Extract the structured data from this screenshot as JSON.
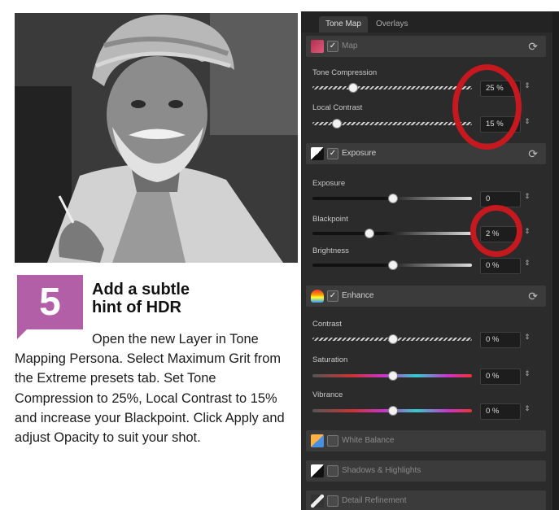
{
  "article": {
    "step_number": "5",
    "title_line1": "Add a subtle",
    "title_line2": "hint of HDR",
    "body": "Open the new Layer in Tone Mapping Persona. Select Maximum Grit from the Extreme presets tab. Set Tone Compression to 25%, Local Contrast to 15% and increase your Blackpoint. Click Apply and adjust Opacity to suit your shot."
  },
  "panel": {
    "tabs": [
      {
        "label": "Tone Map",
        "active": true
      },
      {
        "label": "Overlays",
        "active": false
      }
    ],
    "sections": {
      "map": {
        "label": "Map",
        "controls": [
          {
            "label": "Tone Compression",
            "value": "25 %",
            "level": 0.25
          },
          {
            "label": "Local Contrast",
            "value": "15 %",
            "level": 0.15
          }
        ]
      },
      "exposure": {
        "label": "Exposure",
        "controls": [
          {
            "label": "Exposure",
            "value": "0",
            "level": 0.5
          },
          {
            "label": "Blackpoint",
            "value": "2 %",
            "level": 0.35
          },
          {
            "label": "Brightness",
            "value": "0 %",
            "level": 0.5
          }
        ]
      },
      "enhance": {
        "label": "Enhance",
        "controls": [
          {
            "label": "Contrast",
            "value": "0 %",
            "level": 0.5
          },
          {
            "label": "Saturation",
            "value": "0 %",
            "level": 0.5
          },
          {
            "label": "Vibrance",
            "value": "0 %",
            "level": 0.5
          }
        ]
      },
      "white_balance": {
        "label": "White Balance"
      },
      "shadows_highlights": {
        "label": "Shadows & Highlights"
      },
      "detail_refinement": {
        "label": "Detail Refinement"
      }
    },
    "reset_icon": "refresh-icon",
    "check_glyph": "✓",
    "spin_glyph": "⇕"
  },
  "colors": {
    "badge": "#b25fa8",
    "panel_bg": "#2b2b2b",
    "highlight_ring": "#c6181f"
  }
}
